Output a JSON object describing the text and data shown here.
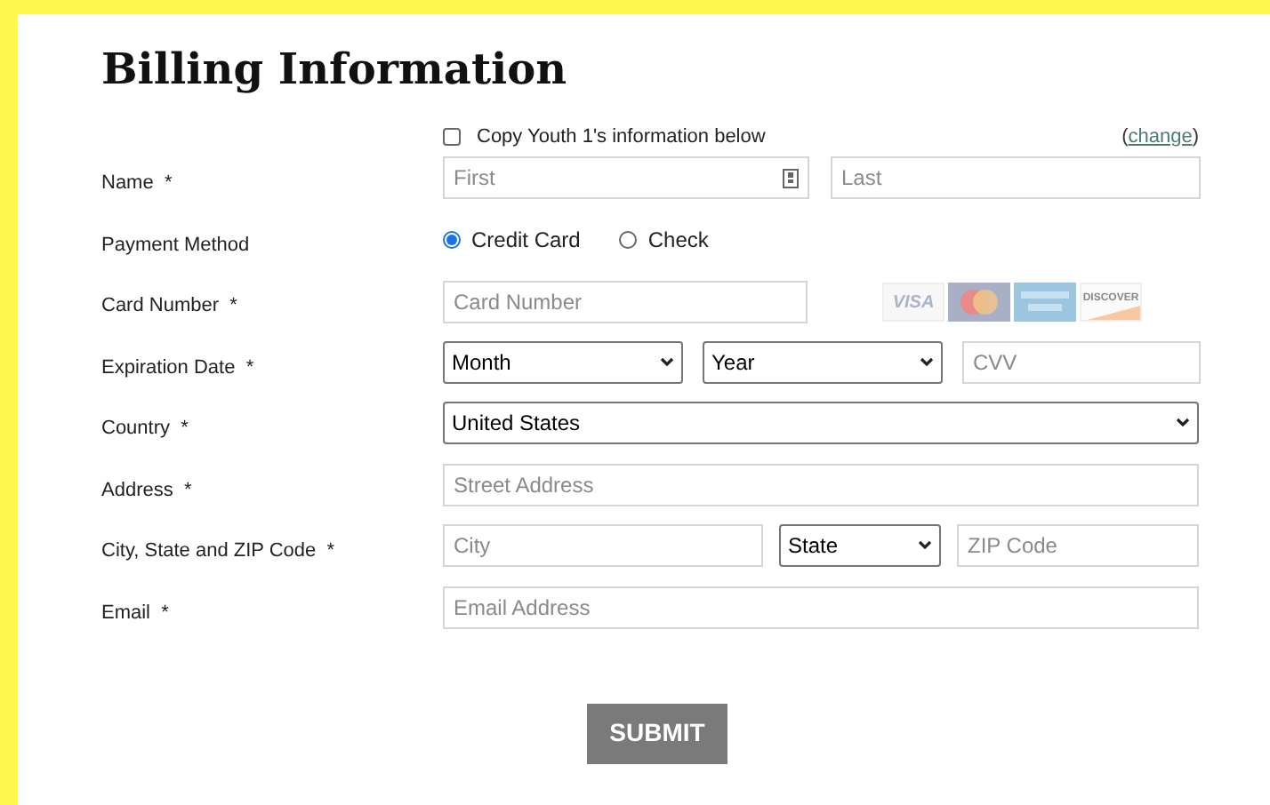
{
  "title": "Billing Information",
  "copy": {
    "label": "Copy Youth 1's information below",
    "checked": false,
    "link_open": "(",
    "link": "change",
    "link_close": ")"
  },
  "rows": [
    {
      "kind": "name",
      "label": "Name",
      "required": "*",
      "fields": [
        {
          "placeholder": "First"
        },
        {
          "placeholder": "Last"
        }
      ]
    },
    {
      "kind": "radio",
      "label": "Payment Method",
      "options": [
        {
          "label": "Credit Card",
          "selected": true
        },
        {
          "label": "Check",
          "selected": false
        }
      ]
    },
    {
      "kind": "card",
      "label": "Card Number",
      "required": "*",
      "fields": [
        {
          "placeholder": "Card Number"
        }
      ],
      "cards": [
        {
          "kind": "visa",
          "text": "VISA"
        },
        {
          "kind": "mastercard"
        },
        {
          "kind": "amex"
        },
        {
          "kind": "discover",
          "text": "DISCOVER"
        }
      ]
    },
    {
      "kind": "expiry",
      "label": "Expiration Date",
      "required": "*",
      "selects": [
        {
          "value": "Month"
        },
        {
          "value": "Year"
        }
      ],
      "fields": [
        {
          "placeholder": "CVV"
        }
      ]
    },
    {
      "kind": "select",
      "label": "Country",
      "required": "*",
      "selects": [
        {
          "value": "United States"
        }
      ]
    },
    {
      "kind": "text",
      "label": "Address",
      "required": "*",
      "fields": [
        {
          "placeholder": "Street Address"
        }
      ]
    },
    {
      "kind": "city",
      "label": "City, State and ZIP Code",
      "required": "*",
      "fields": [
        {
          "placeholder": "City"
        },
        {
          "placeholder": "ZIP Code"
        }
      ],
      "selects": [
        {
          "value": "State"
        }
      ]
    },
    {
      "kind": "text",
      "label": "Email",
      "required": "*",
      "fields": [
        {
          "placeholder": "Email Address"
        }
      ]
    }
  ],
  "submit": "SUBMIT"
}
